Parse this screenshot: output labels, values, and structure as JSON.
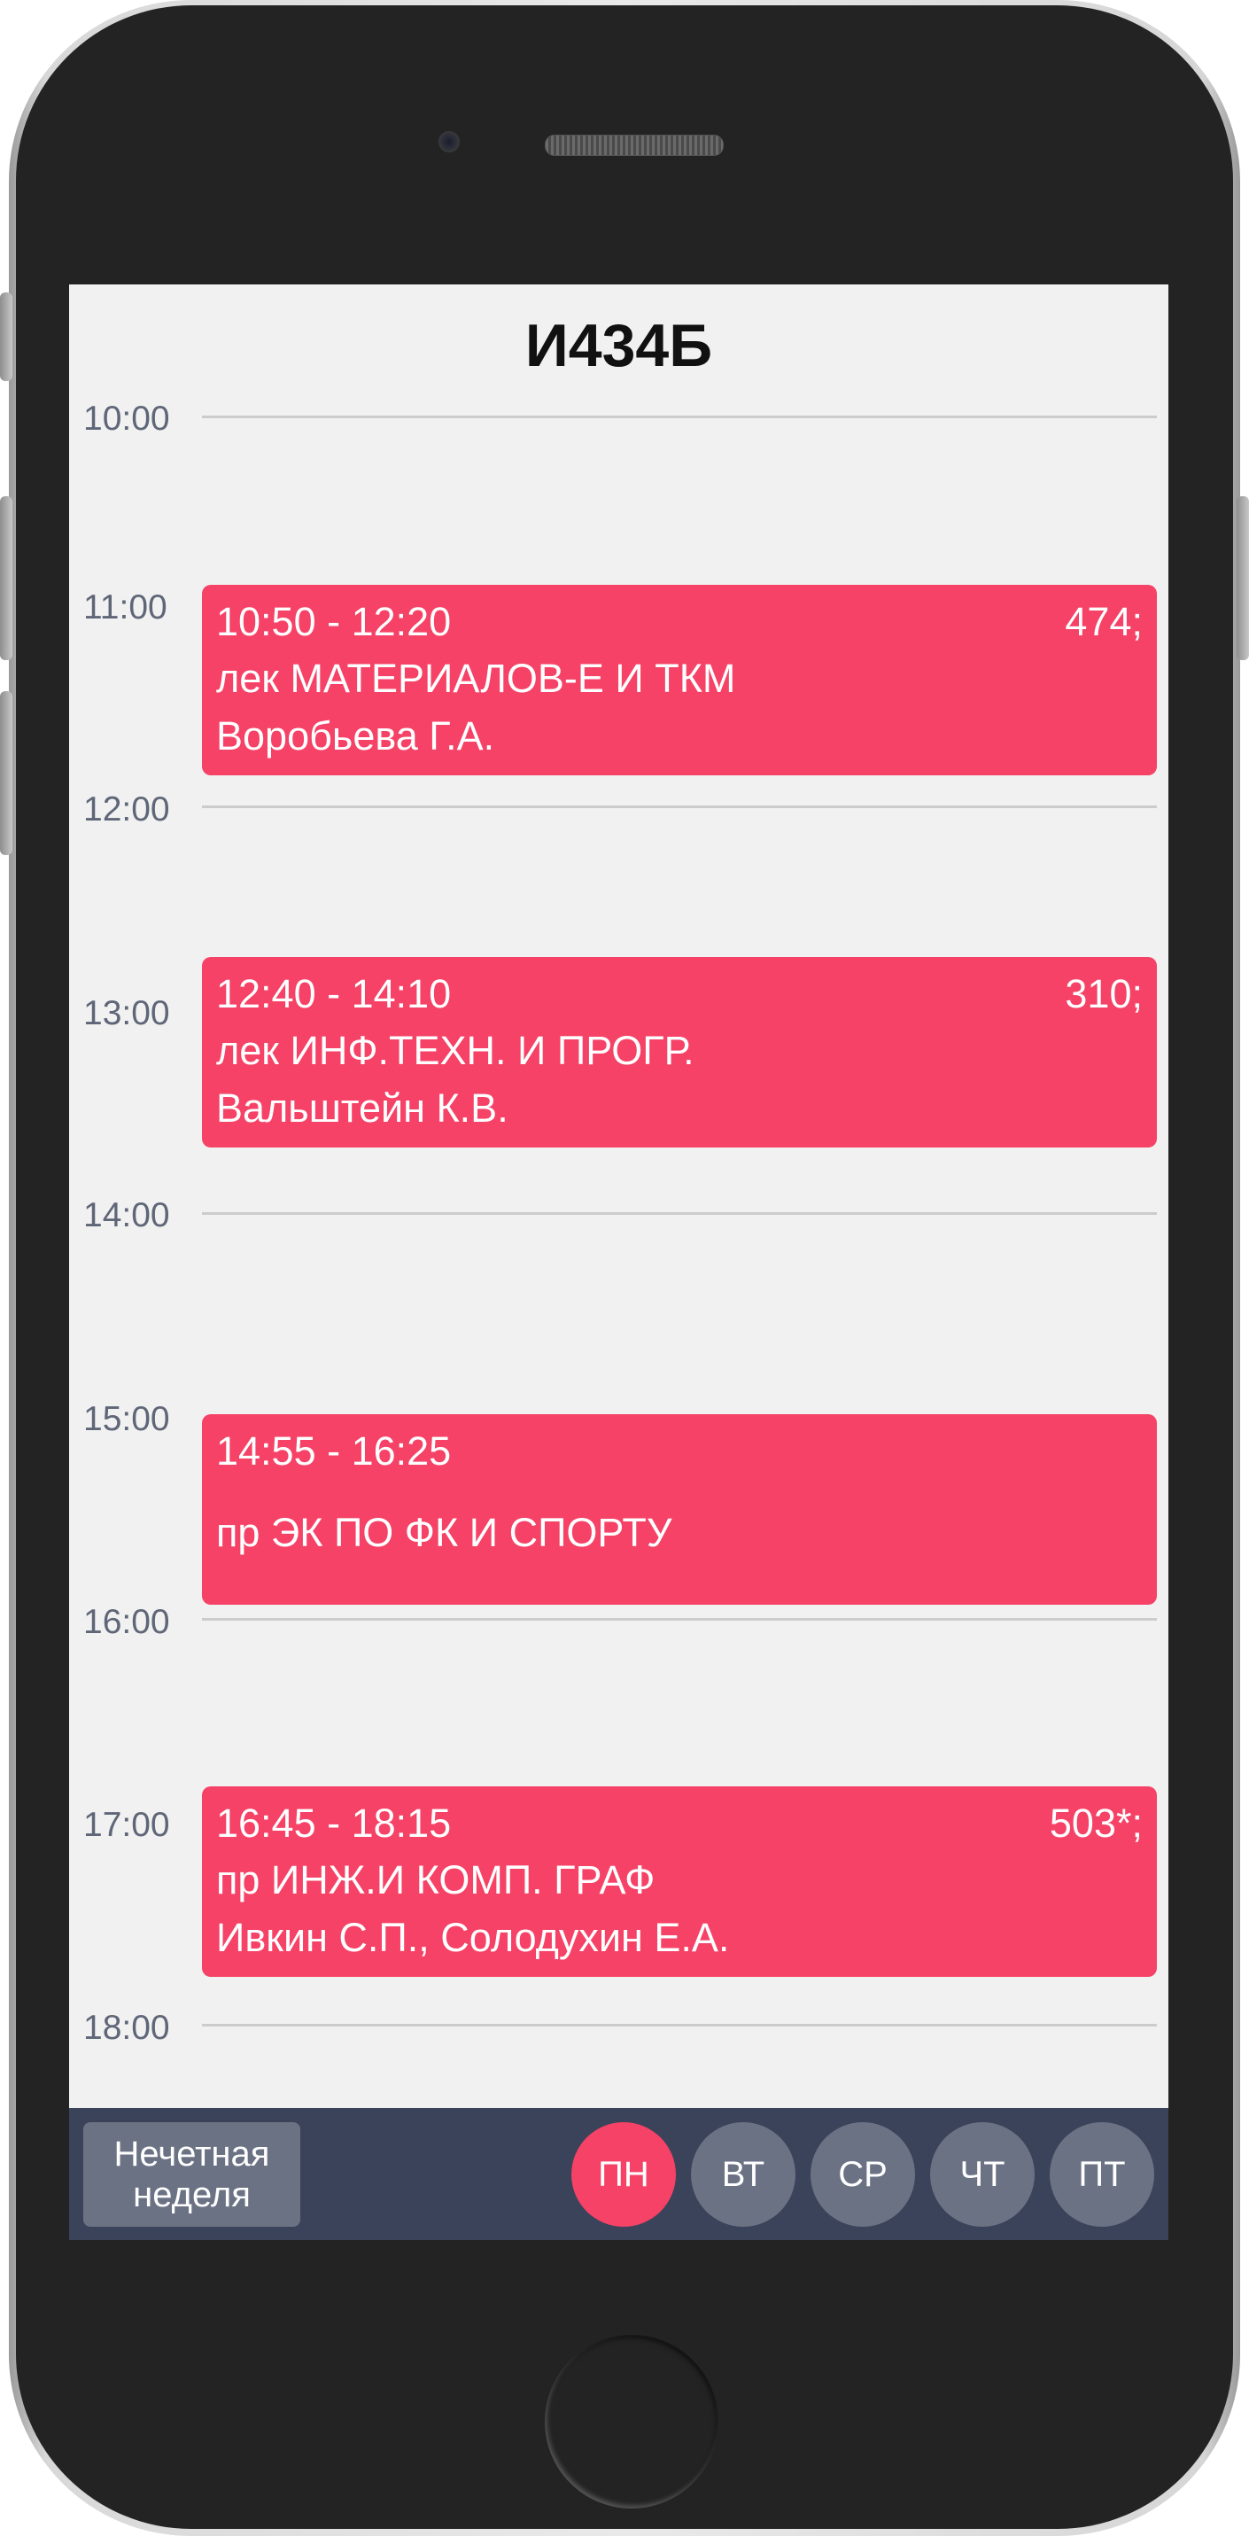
{
  "title": "И434Б",
  "hours": [
    "10:00",
    "11:00",
    "12:00",
    "13:00",
    "14:00",
    "15:00",
    "16:00",
    "17:00",
    "18:00"
  ],
  "lessons": [
    {
      "time": "10:50 - 12:20",
      "room": "474;",
      "subject": "лек МАТЕРИАЛОВ-Е И ТКМ",
      "teacher": "Воробьева Г.А."
    },
    {
      "time": "12:40 - 14:10",
      "room": "310;",
      "subject": "лек ИНФ.ТЕХН. И ПРОГР.",
      "teacher": "Вальштейн К.В."
    },
    {
      "time": "14:55 - 16:25",
      "room": "",
      "subject": "пр ЭК ПО ФК И СПОРТУ",
      "teacher": ""
    },
    {
      "time": "16:45 - 18:15",
      "room": "503*;",
      "subject": "пр ИНЖ.И КОМП. ГРАФ",
      "teacher": "Ивкин С.П., Солодухин Е.А."
    }
  ],
  "bottom_bar": {
    "week_button": "Нечетная неделя",
    "days": [
      "ПН",
      "ВТ",
      "СР",
      "ЧТ",
      "ПТ"
    ],
    "active_day": "ПН"
  },
  "colors": {
    "accent": "#f54266",
    "bar": "#3a4359",
    "button": "#6b7284",
    "screen_bg": "#f1f1f1"
  }
}
